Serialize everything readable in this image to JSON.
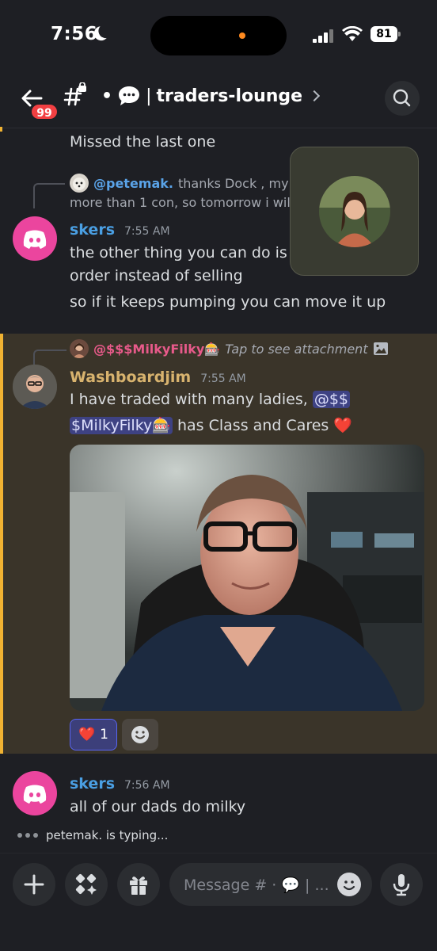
{
  "status_bar": {
    "time": "7:56",
    "battery": "81"
  },
  "header": {
    "unread_badge": "99",
    "channel_prefix": "•",
    "channel_separator": "|",
    "channel_name": "traders-lounge"
  },
  "messages": {
    "first_line": "Missed the last one",
    "reply1": {
      "mention": "@petemak.",
      "preview_line1": "thanks Dock , my",
      "preview_line2": "more than 1 con, so tomorrow i wil"
    },
    "msg_skers1": {
      "author": "skers",
      "time": "7:55 AM",
      "line1": "the other thing you can do is s",
      "line2": "order instead of selling",
      "line3": "so if it keeps pumping you can move it up"
    },
    "reply2": {
      "mention": "@$$$MilkyFilky🎰",
      "hint": "Tap to see attachment"
    },
    "msg_washboard": {
      "author": "Washboardjim",
      "time": "7:55 AM",
      "line1_text": "I have traded with many ladies,",
      "line1_mention": "@$$",
      "line2_mention": "$MilkyFilky🎰",
      "line2_text": "has Class and Cares ❤️",
      "reaction_emoji": "❤️",
      "reaction_count": "1"
    },
    "msg_skers2": {
      "author": "skers",
      "time": "7:56 AM",
      "line1": "all of our dads do milky"
    },
    "typing": "petemak. is typing..."
  },
  "composer": {
    "placeholder": "Message # · 💬 | ..."
  },
  "colors": {
    "background": "#1e1f24",
    "accent_yellow": "#f0b232",
    "skers_name": "#4a9fe3",
    "washboard_name": "#d8b36e",
    "reply_petemak": "#5aa3e8",
    "reply_milky": "#e85a8a",
    "mention_bg": "#3e4283",
    "badge_red": "#f23f42",
    "discord_pink": "#eb459e"
  }
}
